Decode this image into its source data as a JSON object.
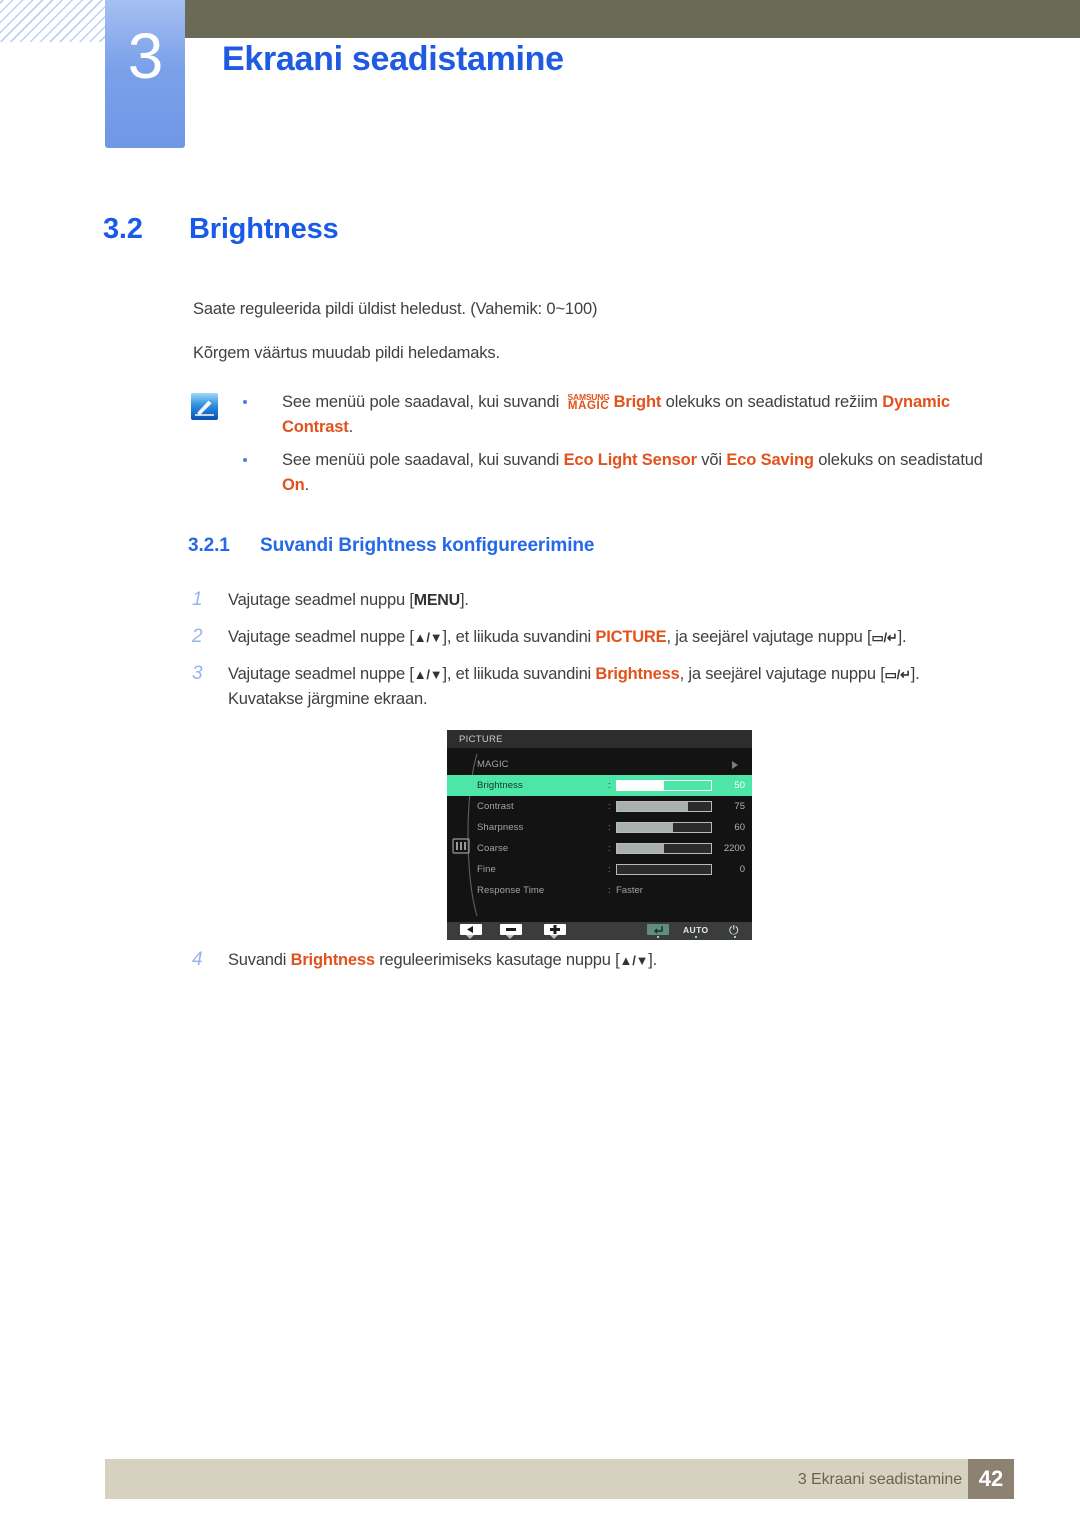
{
  "header": {
    "chapter_number": "3",
    "chapter_title": "Ekraani seadistamine"
  },
  "section": {
    "number": "3.2",
    "title": "Brightness"
  },
  "paragraphs": {
    "p1": "Saate reguleerida pildi üldist heledust. (Vahemik: 0~100)",
    "p2": "Kõrgem väärtus muudab pildi heledamaks."
  },
  "note": {
    "icon": "note-pencil-icon",
    "items": [
      {
        "t1": "See menüü pole saadaval, kui suvandi ",
        "magic_top": "SAMSUNG",
        "magic_bottom": "MAGIC",
        "hl1": "Bright",
        "t2": " olekuks on seadistatud režiim ",
        "hl2": "Dynamic Contrast",
        "t3": "."
      },
      {
        "t1": "See menüü pole saadaval, kui suvandi ",
        "hl1": "Eco Light Sensor",
        "t2": " või ",
        "hl2": "Eco Saving",
        "t3": " olekuks on seadistatud ",
        "hl3": "On",
        "t4": "."
      }
    ]
  },
  "subsection": {
    "number": "3.2.1",
    "title": "Suvandi Brightness konfigureerimine"
  },
  "steps": [
    {
      "num": "1",
      "t1": "Vajutage seadmel nuppu [",
      "kbd1": "MENU",
      "t2": "]."
    },
    {
      "num": "2",
      "t1": "Vajutage seadmel nuppe [",
      "kbd1": "▲/▼",
      "t2": "], et liikuda suvandini ",
      "hl1": "PICTURE",
      "t3": ", ja seejärel vajutage nuppu [",
      "kbd2": "▭/↵",
      "t4": "]."
    },
    {
      "num": "3",
      "t1": "Vajutage seadmel nuppe [",
      "kbd1": "▲/▼",
      "t2": "], et liikuda suvandini ",
      "hl1": "Brightness",
      "t3": ", ja seejärel vajutage nuppu [",
      "kbd2": "▭/↵",
      "t4": "].",
      "t5": "Kuvatakse järgmine ekraan."
    }
  ],
  "step4": {
    "num": "4",
    "t1": "Suvandi ",
    "hl1": "Brightness",
    "t2": " reguleerimiseks kasutage nuppu [",
    "kbd1": "▲/▼",
    "t3": "]."
  },
  "osd": {
    "title": "PICTURE",
    "rows": [
      {
        "label": "MAGIC",
        "type": "submenu",
        "value": "",
        "fill_pct": 0
      },
      {
        "label": "Brightness",
        "type": "slider",
        "value": "50",
        "fill_pct": 50,
        "selected": true
      },
      {
        "label": "Contrast",
        "type": "slider",
        "value": "75",
        "fill_pct": 75
      },
      {
        "label": "Sharpness",
        "type": "slider",
        "value": "60",
        "fill_pct": 60
      },
      {
        "label": "Coarse",
        "type": "slider",
        "value": "2200",
        "fill_pct": 50
      },
      {
        "label": "Fine",
        "type": "slider",
        "value": "0",
        "fill_pct": 0
      },
      {
        "label": "Response Time",
        "type": "text",
        "value": "Faster"
      }
    ],
    "footer_buttons": [
      {
        "name": "back-button",
        "glyph": "◀"
      },
      {
        "name": "minus-button",
        "glyph": "▬"
      },
      {
        "name": "plus-button",
        "glyph": "✚"
      },
      {
        "name": "enter-button",
        "glyph": "↵"
      },
      {
        "name": "auto-button",
        "label": "AUTO"
      },
      {
        "name": "power-button",
        "glyph": "⏻"
      }
    ]
  },
  "footer": {
    "text": "3 Ekraani seadistamine",
    "page": "42"
  },
  "colors": {
    "accent_blue": "#1a5ae8",
    "highlight_orange": "#e2521d",
    "osd_green": "#4de5a8",
    "olive_bar": "#6b6a56",
    "footer_bar": "#d7d2c0",
    "footer_page_box": "#8d8172"
  }
}
